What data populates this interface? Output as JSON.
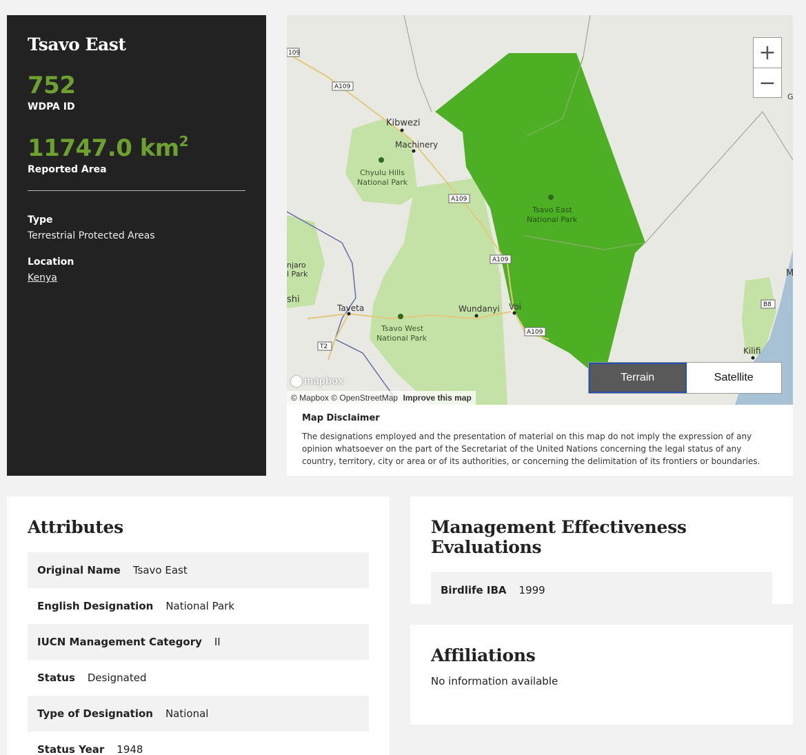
{
  "info": {
    "title": "Tsavo East",
    "wdpa_value": "752",
    "wdpa_label": "WDPA ID",
    "area_value": "11747.0 km",
    "area_sup": "2",
    "area_label": "Reported Area",
    "type_label": "Type",
    "type_value": "Terrestrial Protected Areas",
    "location_label": "Location",
    "location_value": "Kenya"
  },
  "map": {
    "zoom_in": "+",
    "zoom_out": "−",
    "layers": [
      "Terrain",
      "Satellite"
    ],
    "active_layer": "Terrain",
    "attribution_1": "© Mapbox",
    "attribution_2": "© OpenStreetMap",
    "attribution_3": "Improve this map",
    "logo_text": "mapbox",
    "place_labels": {
      "kibwezi": "Kibwezi",
      "machinery": "Machinery",
      "chyulu": "Chyulu Hills",
      "chyulu2": "National Park",
      "tsavo_east": "Tsavo East",
      "tsavo_east2": "National Park",
      "tsavo_west": "Tsavo West",
      "tsavo_west2": "National Park",
      "taveta": "Taveta",
      "wundanyi": "Wundanyi",
      "voi": "Voi",
      "kilifi": "Kilifi",
      "njaro": "njaro",
      "park": "l Park",
      "shi": "shi",
      "m": "M",
      "g": "G"
    },
    "road_shields": [
      "109",
      "A109",
      "A109",
      "A109",
      "A109",
      "T2",
      "B8"
    ],
    "colors": {
      "park_highlight": "#4caf24",
      "park_other": "#c4e1a6",
      "water": "#a7c2d4"
    }
  },
  "disclaimer": {
    "title": "Map Disclaimer",
    "text": "The designations employed and the presentation of material on this map do not imply the expression of any opinion whatsoever on the part of the Secretariat of the United Nations concerning the legal status of any country, territory, city or area or of its authorities, or concerning the delimitation of its frontiers or boundaries."
  },
  "attributes": {
    "title": "Attributes",
    "rows": [
      {
        "k": "Original Name",
        "v": "Tsavo East"
      },
      {
        "k": "English Designation",
        "v": "National Park"
      },
      {
        "k": "IUCN Management Category",
        "v": "II"
      },
      {
        "k": "Status",
        "v": "Designated"
      },
      {
        "k": "Type of Designation",
        "v": "National"
      },
      {
        "k": "Status Year",
        "v": "1948"
      }
    ]
  },
  "me": {
    "title": "Management Effectiveness Evaluations",
    "rows": [
      {
        "k": "Birdlife IBA",
        "v": "1999"
      }
    ]
  },
  "affiliations": {
    "title": "Affiliations",
    "text": "No information available"
  }
}
